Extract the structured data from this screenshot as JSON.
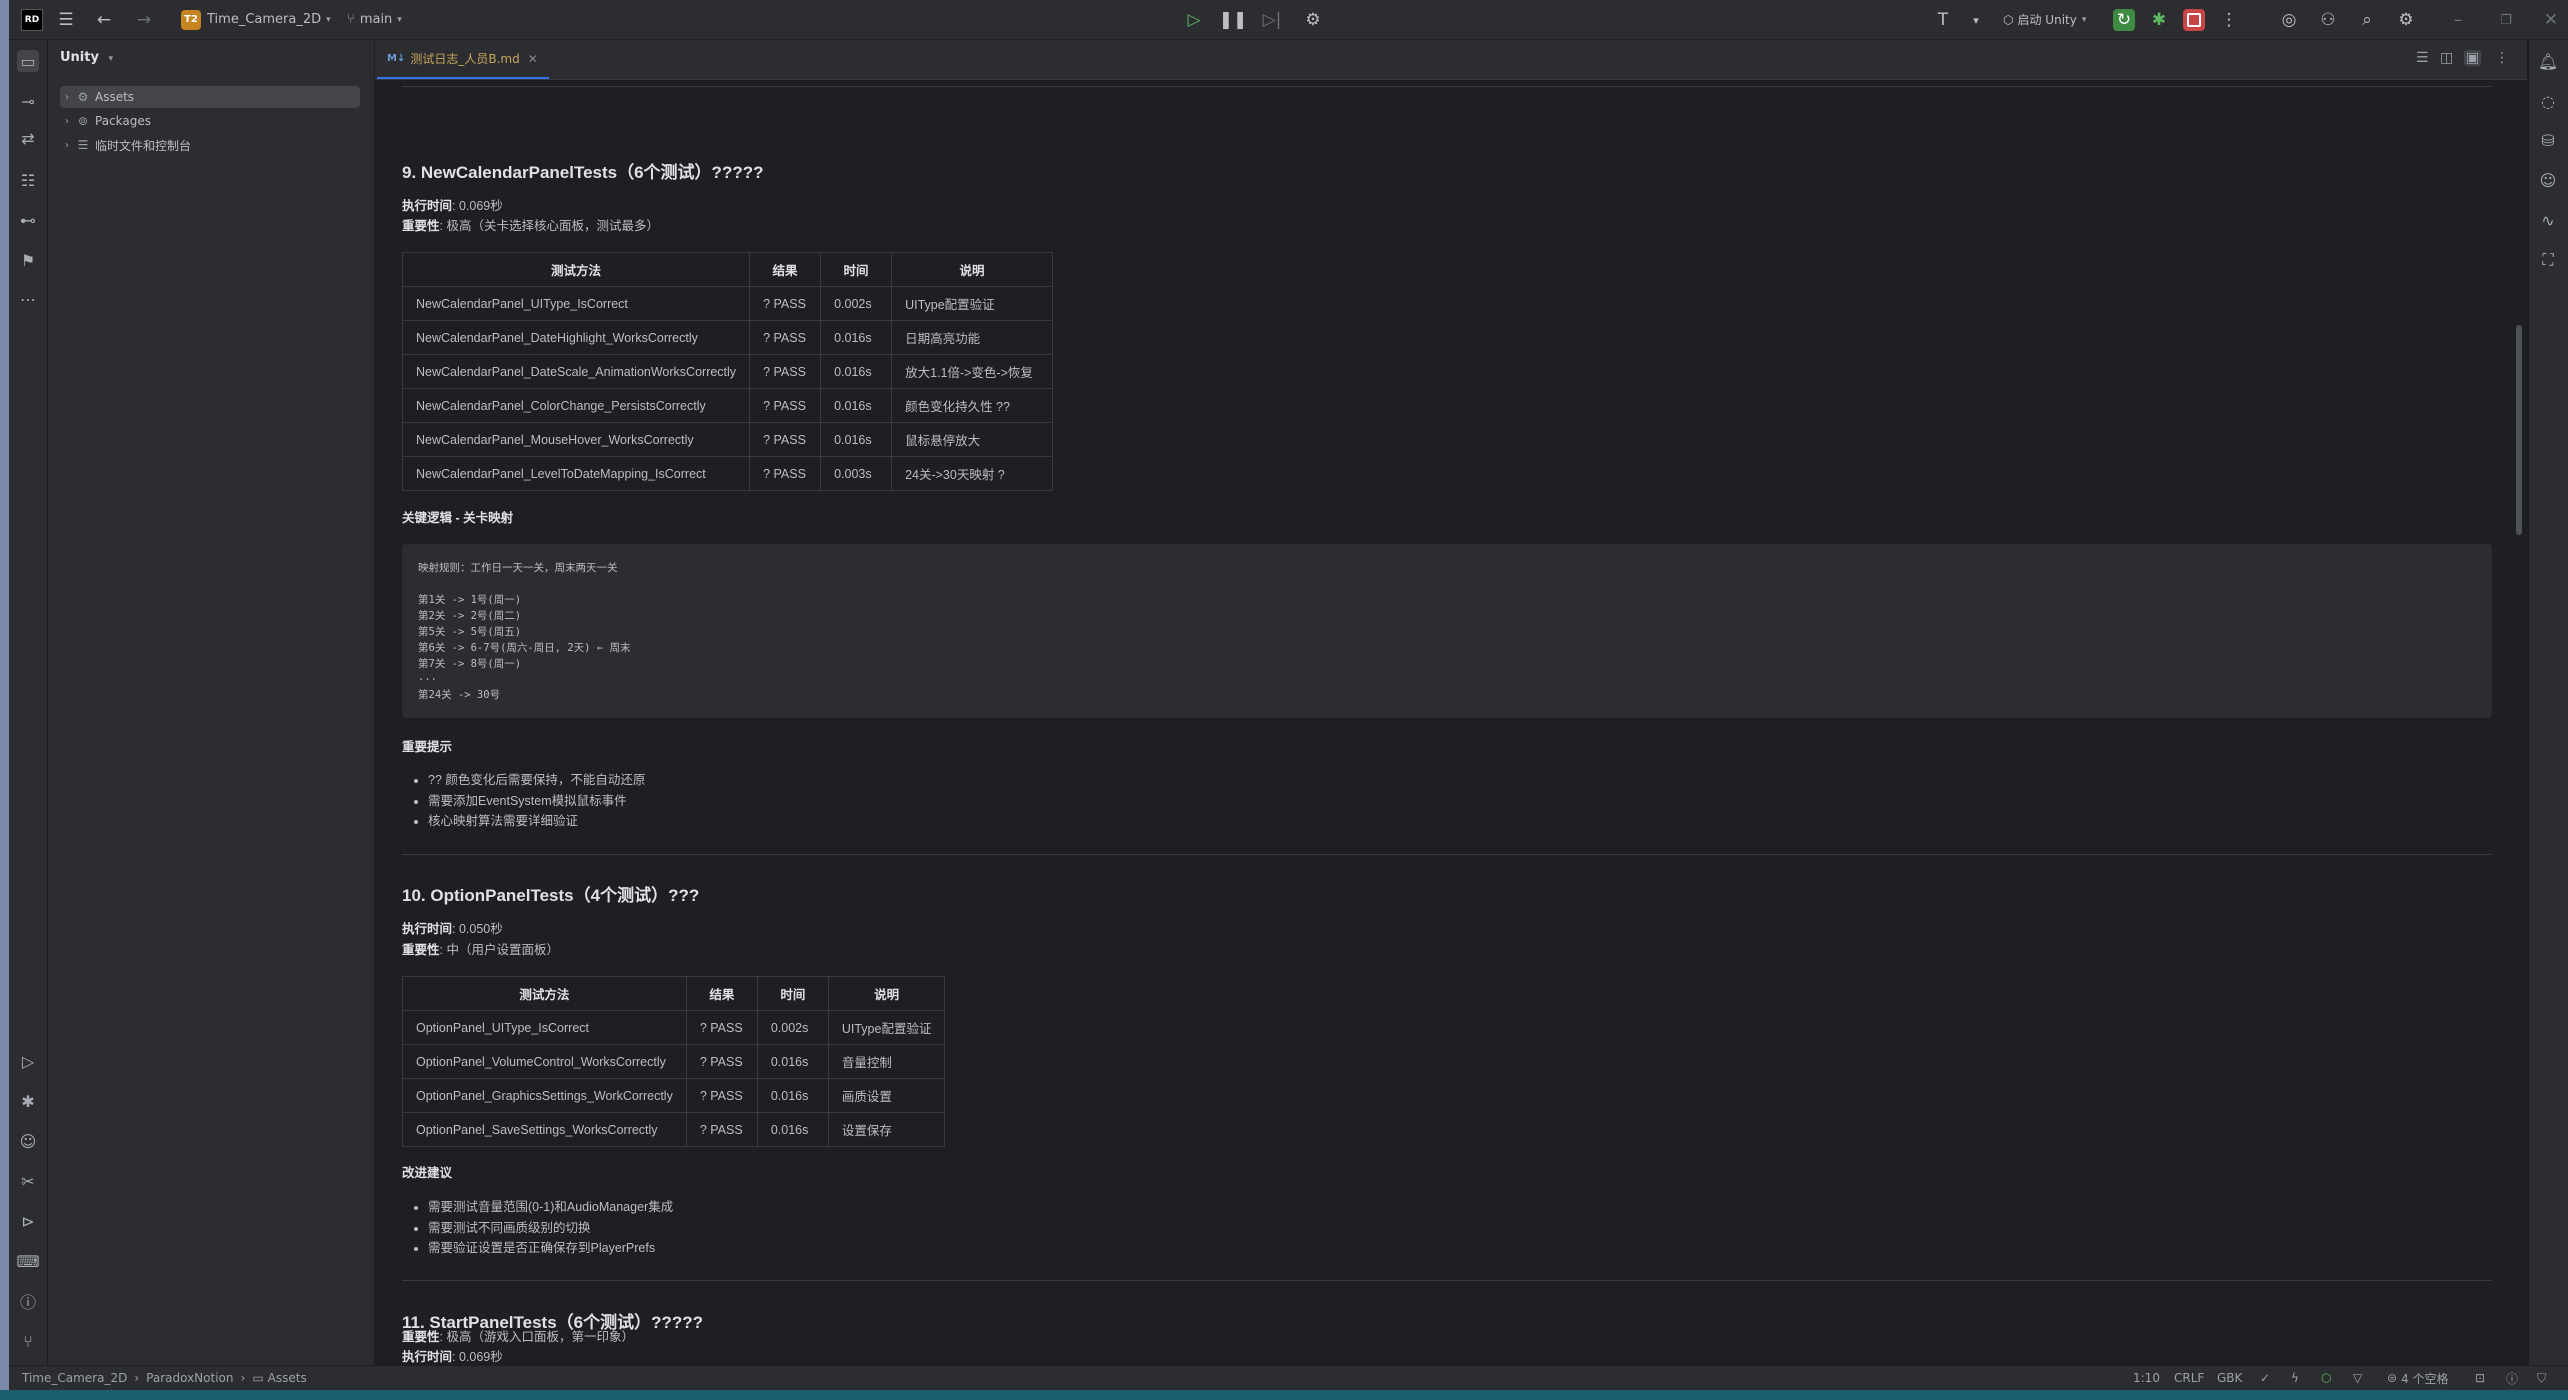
{
  "titlebar": {
    "logo": "RD",
    "project_badge": "T2",
    "project_name": "Time_Camera_2D",
    "branch": "main",
    "run_config": "启动 Unity"
  },
  "project_panel": {
    "title": "Unity",
    "items": [
      {
        "label": "Assets",
        "icon": "gear-folder-icon"
      },
      {
        "label": "Packages",
        "icon": "package-icon"
      },
      {
        "label": "临时文件和控制台",
        "icon": "scratch-icon"
      }
    ]
  },
  "tab": {
    "badge": "M↓",
    "name": "测试日志_人员B.md"
  },
  "doc": {
    "s9": {
      "title": "9. NewCalendarPanelTests（6个测试）?????",
      "exec_label": "执行时间",
      "exec_value": ": 0.069秒",
      "imp_label": "重要性",
      "imp_value": ": 极高（关卡选择核心面板，测试最多）",
      "headers": [
        "测试方法",
        "结果",
        "时间",
        "说明"
      ],
      "rows": [
        [
          "NewCalendarPanel_UIType_IsCorrect",
          "? PASS",
          "0.002s",
          "UIType配置验证"
        ],
        [
          "NewCalendarPanel_DateHighlight_WorksCorrectly",
          "? PASS",
          "0.016s",
          "日期高亮功能"
        ],
        [
          "NewCalendarPanel_DateScale_AnimationWorksCorrectly",
          "? PASS",
          "0.016s",
          "放大1.1倍->变色->恢复"
        ],
        [
          "NewCalendarPanel_ColorChange_PersistsCorrectly",
          "? PASS",
          "0.016s",
          "颜色变化持久性 ??"
        ],
        [
          "NewCalendarPanel_MouseHover_WorksCorrectly",
          "? PASS",
          "0.016s",
          "鼠标悬停放大"
        ],
        [
          "NewCalendarPanel_LevelToDateMapping_IsCorrect",
          "? PASS",
          "0.003s",
          "24关->30天映射 ?"
        ]
      ],
      "logic_label": "关键逻辑 - 关卡映射",
      "code": [
        "映射规则：工作日一天一关，周末两天一关",
        "",
        "第1关 -> 1号(周一)",
        "第2关 -> 2号(周二)",
        "第5关 -> 5号(周五)",
        "第6关 -> 6-7号(周六-周日, 2天) ← 周末",
        "第7关 -> 8号(周一)",
        "...",
        "第24关 -> 30号"
      ],
      "notes_label": "重要提示",
      "notes": [
        "?? 颜色变化后需要保持，不能自动还原",
        "需要添加EventSystem模拟鼠标事件",
        "核心映射算法需要详细验证"
      ]
    },
    "s10": {
      "title": "10. OptionPanelTests（4个测试）???",
      "exec_label": "执行时间",
      "exec_value": ": 0.050秒",
      "imp_label": "重要性",
      "imp_value": ": 中（用户设置面板）",
      "headers": [
        "测试方法",
        "结果",
        "时间",
        "说明"
      ],
      "rows": [
        [
          "OptionPanel_UIType_IsCorrect",
          "? PASS",
          "0.002s",
          "UIType配置验证"
        ],
        [
          "OptionPanel_VolumeControl_WorksCorrectly",
          "? PASS",
          "0.016s",
          "音量控制"
        ],
        [
          "OptionPanel_GraphicsSettings_WorkCorrectly",
          "? PASS",
          "0.016s",
          "画质设置"
        ],
        [
          "OptionPanel_SaveSettings_WorksCorrectly",
          "? PASS",
          "0.016s",
          "设置保存"
        ]
      ],
      "improve_label": "改进建议",
      "improve": [
        "需要测试音量范围(0-1)和AudioManager集成",
        "需要测试不同画质级别的切换",
        "需要验证设置是否正确保存到PlayerPrefs"
      ]
    },
    "s11": {
      "title": "11. StartPanelTests（6个测试）?????",
      "exec_label": "执行时间",
      "exec_value": ": 0.069秒",
      "imp_label": "重要性",
      "imp_value": ": 极高（游戏入口面板，第一印象）"
    }
  },
  "statusbar": {
    "crumbs": [
      "Time_Camera_2D",
      "ParadoxNotion",
      "Assets"
    ],
    "position": "1:10",
    "line_sep": "CRLF",
    "encoding": "GBK",
    "indent": "4 个空格"
  },
  "colors": {
    "background": "#1e1f22",
    "panel": "#2b2d30",
    "accent": "#3574f0",
    "run_green": "#5fb85f",
    "stop_red": "#e05555"
  }
}
